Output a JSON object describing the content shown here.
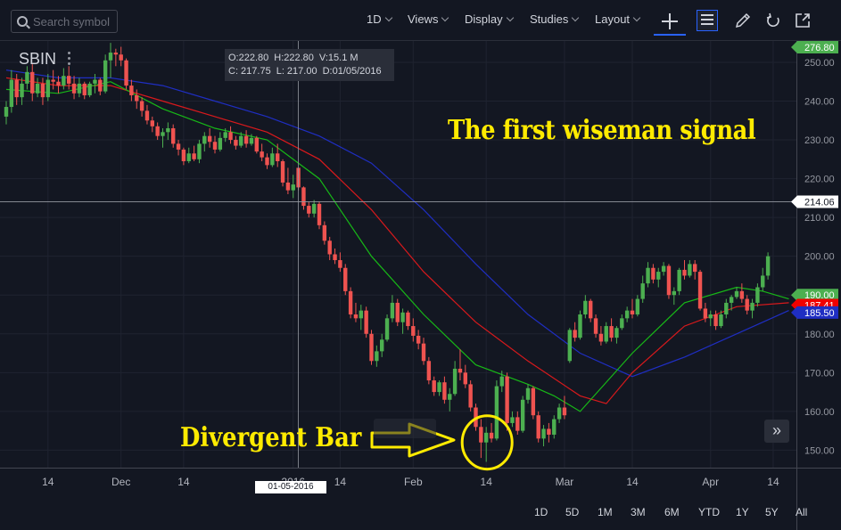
{
  "toolbar": {
    "search_placeholder": "Search symbol",
    "interval": "1D",
    "views": "Views",
    "display": "Display",
    "studies": "Studies",
    "layout": "Layout"
  },
  "symbol": "SBIN",
  "ohlc": {
    "open": "O:222.80",
    "high": "H:222.80",
    "volume": "V:15.1 M",
    "close": "C: 217.75",
    "low": "L: 217.00",
    "date": "D:01/05/2016"
  },
  "annotations": {
    "wiseman": "The first wiseman signal",
    "divergent": "Divergent Bar"
  },
  "crosshair_date": "01-05-2016",
  "date_ranges": [
    "1D",
    "5D",
    "1M",
    "3M",
    "6M",
    "YTD",
    "1Y",
    "5Y",
    "All"
  ],
  "colors": {
    "background": "#131722",
    "bull": "#4caf50",
    "bear": "#ef5350",
    "jaw_blue": "#1f2ec2",
    "teeth_red": "#d9191c",
    "lips_green": "#17b817",
    "annotation": "#ffeb00"
  },
  "icons": [
    "search-icon",
    "plus-icon",
    "news-icon",
    "pencil-icon",
    "undo-icon",
    "popout-icon",
    "double-chevron-right-icon"
  ],
  "chart_data": {
    "type": "candlestick",
    "ylim": [
      145.5,
      255.5
    ],
    "y_ticks": [
      150,
      160,
      170,
      180,
      190,
      200,
      210,
      220,
      230,
      240,
      250
    ],
    "price_labels": [
      {
        "value": 276.8,
        "text": "276.80",
        "color": "#4caf50"
      },
      {
        "value": 214.06,
        "text": "214.06",
        "color": "#ffffff"
      },
      {
        "value": 190.0,
        "text": "190.00",
        "color": "#4caf50"
      },
      {
        "value": 187.41,
        "text": "187.41",
        "color": "#ef0000"
      },
      {
        "value": 185.5,
        "text": "185.50",
        "color": "#1f2ec2"
      }
    ],
    "x_labels": [
      {
        "i": 8,
        "text": "14"
      },
      {
        "i": 22,
        "text": "Dec"
      },
      {
        "i": 34,
        "text": "14"
      },
      {
        "i": 55,
        "text": "2016"
      },
      {
        "i": 64,
        "text": "14"
      },
      {
        "i": 78,
        "text": "Feb"
      },
      {
        "i": 92,
        "text": "14"
      },
      {
        "i": 107,
        "text": "Mar"
      },
      {
        "i": 120,
        "text": "14"
      },
      {
        "i": 135,
        "text": "Apr"
      },
      {
        "i": 147,
        "text": "14"
      }
    ],
    "crosshair": {
      "i": 56,
      "price": 214.06
    },
    "candles": [
      [
        236.0,
        240.0,
        234.0,
        238.5
      ],
      [
        238.5,
        248.0,
        237.0,
        245.5
      ],
      [
        245.5,
        247.0,
        239.0,
        241.0
      ],
      [
        241.0,
        246.0,
        239.0,
        244.5
      ],
      [
        244.5,
        249.0,
        243.0,
        247.5
      ],
      [
        247.5,
        249.5,
        240.0,
        242.0
      ],
      [
        242.0,
        246.0,
        241.0,
        244.5
      ],
      [
        244.5,
        246.0,
        239.0,
        241.0
      ],
      [
        241.0,
        247.0,
        240.0,
        245.5
      ],
      [
        245.5,
        248.0,
        243.0,
        245.0
      ],
      [
        245.0,
        246.5,
        242.0,
        244.0
      ],
      [
        244.0,
        248.5,
        243.0,
        246.5
      ],
      [
        246.5,
        249.0,
        243.0,
        244.5
      ],
      [
        244.5,
        246.5,
        240.5,
        242.0
      ],
      [
        242.0,
        246.0,
        241.0,
        244.5
      ],
      [
        244.5,
        245.0,
        240.5,
        241.5
      ],
      [
        241.5,
        245.0,
        241.0,
        244.5
      ],
      [
        244.5,
        247.0,
        242.0,
        245.5
      ],
      [
        245.5,
        246.0,
        241.5,
        242.5
      ],
      [
        242.5,
        252.0,
        242.0,
        250.5
      ],
      [
        250.5,
        255.0,
        246.0,
        252.5
      ],
      [
        252.5,
        253.5,
        249.0,
        252.0
      ],
      [
        252.0,
        254.0,
        249.0,
        250.5
      ],
      [
        250.5,
        251.0,
        243.0,
        244.0
      ],
      [
        244.0,
        245.5,
        240.0,
        241.5
      ],
      [
        241.5,
        243.0,
        238.0,
        240.0
      ],
      [
        240.0,
        241.0,
        236.0,
        237.5
      ],
      [
        237.5,
        239.0,
        234.0,
        235.0
      ],
      [
        235.0,
        236.0,
        232.0,
        233.5
      ],
      [
        233.5,
        234.5,
        230.0,
        231.0
      ],
      [
        231.0,
        233.0,
        228.0,
        232.0
      ],
      [
        232.0,
        234.5,
        230.0,
        233.0
      ],
      [
        233.0,
        234.0,
        228.0,
        229.0
      ],
      [
        229.0,
        230.0,
        226.0,
        227.5
      ],
      [
        227.5,
        228.0,
        223.5,
        224.5
      ],
      [
        224.5,
        228.0,
        224.0,
        226.5
      ],
      [
        226.5,
        228.5,
        224.5,
        225.0
      ],
      [
        225.0,
        230.0,
        224.0,
        229.0
      ],
      [
        229.0,
        232.0,
        227.0,
        231.0
      ],
      [
        231.0,
        233.0,
        228.0,
        229.5
      ],
      [
        229.5,
        231.0,
        226.5,
        227.5
      ],
      [
        227.5,
        232.0,
        227.0,
        230.5
      ],
      [
        230.5,
        233.0,
        229.5,
        232.0
      ],
      [
        232.0,
        233.5,
        229.0,
        230.0
      ],
      [
        230.0,
        231.0,
        227.5,
        228.5
      ],
      [
        228.5,
        232.0,
        228.0,
        231.0
      ],
      [
        231.0,
        232.5,
        228.0,
        229.0
      ],
      [
        229.0,
        231.5,
        228.5,
        230.5
      ],
      [
        230.5,
        231.0,
        226.5,
        227.0
      ],
      [
        227.0,
        229.0,
        224.5,
        225.5
      ],
      [
        225.5,
        226.5,
        222.5,
        223.5
      ],
      [
        223.5,
        228.0,
        223.0,
        226.5
      ],
      [
        226.5,
        229.0,
        223.0,
        224.5
      ],
      [
        224.5,
        225.0,
        218.0,
        219.0
      ],
      [
        219.0,
        222.8,
        216.0,
        217.0
      ],
      [
        217.0,
        221.0,
        215.0,
        218.5
      ],
      [
        222.8,
        222.8,
        217.0,
        217.75
      ],
      [
        217.75,
        218.0,
        212.0,
        213.0
      ],
      [
        213.0,
        214.0,
        210.0,
        211.0
      ],
      [
        211.0,
        214.5,
        210.0,
        213.5
      ],
      [
        213.5,
        214.0,
        207.0,
        208.0
      ],
      [
        208.0,
        209.0,
        203.0,
        204.0
      ],
      [
        204.0,
        205.0,
        199.0,
        200.5
      ],
      [
        200.5,
        202.0,
        198.0,
        199.0
      ],
      [
        199.0,
        201.0,
        196.0,
        197.0
      ],
      [
        197.0,
        198.0,
        190.0,
        191.0
      ],
      [
        191.0,
        192.0,
        184.0,
        185.0
      ],
      [
        185.0,
        188.0,
        183.0,
        184.0
      ],
      [
        184.0,
        187.5,
        181.0,
        186.0
      ],
      [
        186.0,
        187.0,
        179.0,
        180.0
      ],
      [
        180.0,
        181.0,
        172.0,
        173.0
      ],
      [
        173.0,
        177.0,
        171.5,
        175.5
      ],
      [
        175.5,
        180.0,
        174.0,
        178.5
      ],
      [
        178.5,
        185.0,
        178.0,
        184.0
      ],
      [
        184.0,
        190.0,
        183.0,
        188.0
      ],
      [
        188.0,
        189.0,
        182.0,
        183.0
      ],
      [
        183.0,
        186.5,
        180.0,
        185.5
      ],
      [
        185.5,
        186.0,
        181.0,
        182.0
      ],
      [
        182.0,
        184.0,
        178.0,
        179.5
      ],
      [
        179.5,
        181.0,
        176.0,
        177.5
      ],
      [
        177.5,
        179.0,
        172.0,
        173.0
      ],
      [
        173.0,
        174.0,
        167.0,
        168.0
      ],
      [
        168.0,
        169.0,
        164.0,
        165.0
      ],
      [
        165.0,
        168.0,
        164.0,
        167.5
      ],
      [
        167.5,
        169.0,
        162.0,
        163.0
      ],
      [
        163.0,
        166.0,
        160.0,
        164.5
      ],
      [
        164.5,
        173.0,
        164.0,
        171.0
      ],
      [
        171.0,
        176.0,
        168.0,
        170.0
      ],
      [
        170.0,
        172.0,
        166.0,
        167.0
      ],
      [
        167.0,
        168.0,
        160.0,
        161.0
      ],
      [
        161.0,
        162.0,
        155.0,
        156.0
      ],
      [
        156.0,
        158.0,
        148.0,
        152.0
      ],
      [
        152.0,
        156.0,
        147.0,
        154.5
      ],
      [
        154.5,
        157.0,
        152.0,
        153.0
      ],
      [
        153.0,
        168.0,
        152.5,
        166.5
      ],
      [
        166.5,
        170.5,
        165.0,
        169.0
      ],
      [
        169.0,
        170.0,
        155.0,
        157.0
      ],
      [
        157.0,
        160.0,
        156.0,
        158.5
      ],
      [
        158.5,
        160.0,
        154.0,
        155.0
      ],
      [
        155.0,
        164.0,
        154.5,
        163.0
      ],
      [
        163.0,
        167.0,
        162.0,
        166.0
      ],
      [
        166.0,
        166.5,
        158.0,
        159.0
      ],
      [
        159.0,
        160.0,
        152.0,
        153.0
      ],
      [
        153.0,
        156.5,
        151.0,
        155.5
      ],
      [
        155.5,
        157.0,
        152.0,
        154.0
      ],
      [
        154.0,
        159.0,
        153.0,
        158.0
      ],
      [
        158.0,
        162.0,
        157.0,
        161.0
      ],
      [
        161.0,
        164.0,
        158.0,
        159.0
      ],
      [
        173.0,
        181.5,
        172.5,
        181.0
      ],
      [
        181.0,
        183.0,
        178.0,
        179.0
      ],
      [
        179.0,
        186.0,
        178.5,
        185.0
      ],
      [
        185.0,
        190.0,
        184.0,
        188.5
      ],
      [
        188.5,
        189.0,
        183.0,
        184.0
      ],
      [
        184.0,
        185.0,
        179.0,
        180.0
      ],
      [
        180.0,
        182.0,
        177.0,
        178.0
      ],
      [
        178.0,
        183.0,
        177.5,
        182.0
      ],
      [
        182.0,
        184.0,
        178.0,
        179.0
      ],
      [
        179.0,
        182.0,
        177.5,
        181.5
      ],
      [
        181.5,
        185.0,
        181.0,
        184.0
      ],
      [
        184.0,
        187.0,
        183.0,
        186.0
      ],
      [
        186.0,
        189.0,
        184.0,
        185.0
      ],
      [
        185.0,
        190.0,
        184.5,
        189.0
      ],
      [
        189.0,
        195.0,
        188.0,
        193.0
      ],
      [
        193.0,
        198.5,
        192.0,
        197.0
      ],
      [
        197.0,
        198.0,
        193.0,
        194.0
      ],
      [
        194.0,
        197.0,
        192.0,
        196.0
      ],
      [
        196.0,
        198.5,
        195.0,
        197.5
      ],
      [
        197.5,
        198.0,
        189.0,
        190.0
      ],
      [
        190.0,
        192.0,
        187.5,
        191.0
      ],
      [
        191.0,
        197.0,
        190.0,
        196.5
      ],
      [
        196.5,
        199.0,
        194.0,
        195.0
      ],
      [
        195.0,
        199.0,
        194.5,
        198.0
      ],
      [
        198.0,
        199.0,
        194.0,
        196.0
      ],
      [
        196.0,
        196.5,
        186.0,
        186.5
      ],
      [
        186.5,
        188.0,
        183.0,
        184.0
      ],
      [
        184.0,
        186.0,
        182.0,
        185.0
      ],
      [
        185.0,
        186.0,
        181.0,
        182.0
      ],
      [
        182.0,
        186.0,
        181.5,
        185.0
      ],
      [
        185.0,
        189.0,
        184.0,
        188.0
      ],
      [
        188.0,
        190.0,
        186.0,
        189.5
      ],
      [
        189.5,
        192.0,
        189.0,
        191.0
      ],
      [
        191.0,
        193.0,
        188.0,
        189.0
      ],
      [
        189.0,
        190.0,
        185.0,
        186.0
      ],
      [
        186.0,
        189.0,
        184.0,
        188.0
      ],
      [
        188.0,
        193.0,
        187.0,
        192.0
      ],
      [
        192.0,
        197.0,
        191.0,
        195.0
      ],
      [
        195.0,
        201.0,
        194.0,
        200.0
      ]
    ],
    "alligator": {
      "jaw": [
        [
          0,
          248
        ],
        [
          10,
          246
        ],
        [
          20,
          246
        ],
        [
          30,
          244
        ],
        [
          40,
          240
        ],
        [
          50,
          236
        ],
        [
          60,
          231
        ],
        [
          70,
          224
        ],
        [
          80,
          212
        ],
        [
          90,
          198
        ],
        [
          100,
          185
        ],
        [
          110,
          175
        ],
        [
          120,
          169
        ],
        [
          130,
          174
        ],
        [
          140,
          180
        ],
        [
          150,
          186
        ]
      ],
      "teeth": [
        [
          0,
          246
        ],
        [
          10,
          244
        ],
        [
          20,
          244
        ],
        [
          30,
          240
        ],
        [
          40,
          236
        ],
        [
          50,
          232
        ],
        [
          60,
          225
        ],
        [
          70,
          212
        ],
        [
          80,
          196
        ],
        [
          90,
          183
        ],
        [
          100,
          173
        ],
        [
          110,
          164
        ],
        [
          115,
          162
        ],
        [
          120,
          170
        ],
        [
          130,
          182
        ],
        [
          140,
          187
        ],
        [
          150,
          188
        ]
      ],
      "lips": [
        [
          0,
          243
        ],
        [
          10,
          242
        ],
        [
          20,
          245
        ],
        [
          30,
          238
        ],
        [
          40,
          233
        ],
        [
          50,
          230
        ],
        [
          60,
          220
        ],
        [
          70,
          200
        ],
        [
          80,
          185
        ],
        [
          90,
          172
        ],
        [
          100,
          167
        ],
        [
          105,
          164
        ],
        [
          110,
          160
        ],
        [
          120,
          175
        ],
        [
          130,
          188
        ],
        [
          140,
          192
        ],
        [
          145,
          191
        ],
        [
          150,
          189
        ]
      ]
    }
  }
}
